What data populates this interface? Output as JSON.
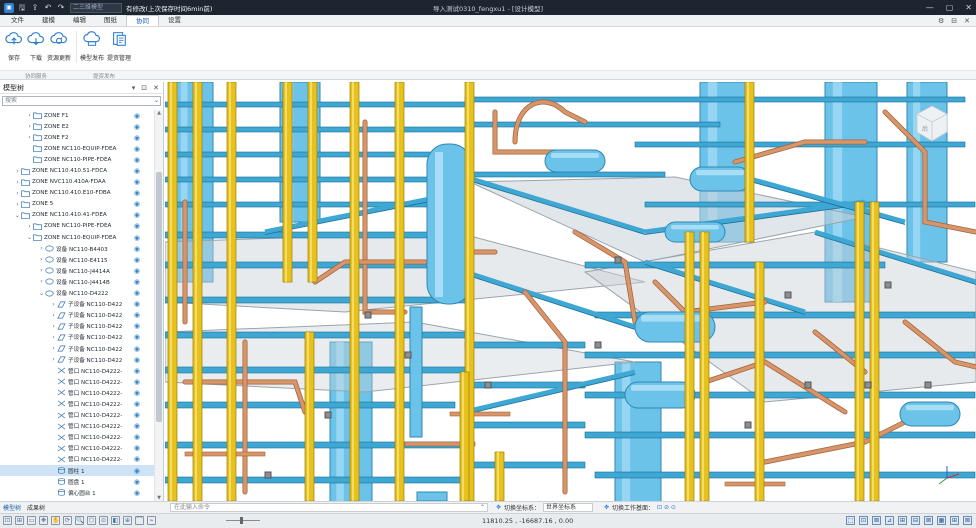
{
  "titlebar": {
    "combo_text": "二三维模型",
    "status_text": "有修改(上次保存时间6min前)",
    "window_title": "导入测试0310_fengxu1 - [设计模型]",
    "minimize": "—",
    "maximize": "▢",
    "close": "✕"
  },
  "tabs": {
    "items": [
      "文件",
      "建模",
      "编辑",
      "图纸",
      "协同",
      "设置"
    ],
    "active_index": 4,
    "right_controls": [
      "⚙",
      "⊟",
      "✕"
    ]
  },
  "ribbon": {
    "buttons": [
      {
        "label": "保存",
        "icon": "save-cloud-icon"
      },
      {
        "label": "下载",
        "icon": "download-cloud-icon"
      },
      {
        "label": "资源更新",
        "icon": "refresh-cloud-icon"
      },
      {
        "label": "模型发布",
        "icon": "publish-cloud-icon"
      },
      {
        "label": "提资管理",
        "icon": "document-manage-icon"
      }
    ],
    "groups": [
      "协同服务",
      "提资发布"
    ]
  },
  "panel": {
    "title": "模型树",
    "search_placeholder": "搜索",
    "controls": [
      "▾",
      "⊡",
      "✕"
    ]
  },
  "tree": [
    {
      "indent": 3,
      "exp": "›",
      "icon": "folder",
      "label": "ZONE F1"
    },
    {
      "indent": 3,
      "exp": "›",
      "icon": "folder",
      "label": "ZONE E2"
    },
    {
      "indent": 3,
      "exp": "›",
      "icon": "folder",
      "label": "ZONE F2"
    },
    {
      "indent": 3,
      "exp": "",
      "icon": "folder",
      "label": "ZONE NC110-EQUIP-FDEA"
    },
    {
      "indent": 3,
      "exp": "",
      "icon": "folder",
      "label": "ZONE NC110-PIPE-FDEA"
    },
    {
      "indent": 2,
      "exp": "›",
      "icon": "folder",
      "label": "ZONE NC110.410.51-FDCA"
    },
    {
      "indent": 2,
      "exp": "›",
      "icon": "folder",
      "label": "ZONE NVC110.410A-FDAA"
    },
    {
      "indent": 2,
      "exp": "›",
      "icon": "folder",
      "label": "ZONE NC110.410.E10-FDBA"
    },
    {
      "indent": 2,
      "exp": "›",
      "icon": "folder",
      "label": "ZONE 5"
    },
    {
      "indent": 2,
      "exp": "⌄",
      "icon": "folder",
      "label": "ZONE NC110.410.41-FDEA"
    },
    {
      "indent": 3,
      "exp": "›",
      "icon": "folder",
      "label": "ZONE NC110-PIPE-FDEA"
    },
    {
      "indent": 3,
      "exp": "⌄",
      "icon": "folder",
      "label": "ZONE NC110-EQUIP-FDEA"
    },
    {
      "indent": 4,
      "exp": "›",
      "icon": "equip",
      "label": "设备 NC110-B4403"
    },
    {
      "indent": 4,
      "exp": "›",
      "icon": "equip",
      "label": "设备 NC110-E4115"
    },
    {
      "indent": 4,
      "exp": "›",
      "icon": "equip",
      "label": "设备 NC110-J4414A"
    },
    {
      "indent": 4,
      "exp": "›",
      "icon": "equip",
      "label": "设备 NC110-J4414B"
    },
    {
      "indent": 4,
      "exp": "⌄",
      "icon": "equip",
      "label": "设备 NC110-D4222"
    },
    {
      "indent": 5,
      "exp": "›",
      "icon": "subequip",
      "label": "子设备 NC110-D422"
    },
    {
      "indent": 5,
      "exp": "›",
      "icon": "subequip",
      "label": "子设备 NC110-D422"
    },
    {
      "indent": 5,
      "exp": "›",
      "icon": "subequip",
      "label": "子设备 NC110-D422"
    },
    {
      "indent": 5,
      "exp": "›",
      "icon": "subequip",
      "label": "子设备 NC110-D422"
    },
    {
      "indent": 5,
      "exp": "›",
      "icon": "subequip",
      "label": "子设备 NC110-D422"
    },
    {
      "indent": 5,
      "exp": "›",
      "icon": "subequip",
      "label": "子设备 NC110-D422"
    },
    {
      "indent": 5,
      "exp": "",
      "icon": "nozzle",
      "label": "管口 NC110-D4222-"
    },
    {
      "indent": 5,
      "exp": "",
      "icon": "nozzle",
      "label": "管口 NC110-D4222-"
    },
    {
      "indent": 5,
      "exp": "",
      "icon": "nozzle",
      "label": "管口 NC110-D4222-"
    },
    {
      "indent": 5,
      "exp": "",
      "icon": "nozzle",
      "label": "管口 NC110-D4222-"
    },
    {
      "indent": 5,
      "exp": "",
      "icon": "nozzle",
      "label": "管口 NC110-D4222-"
    },
    {
      "indent": 5,
      "exp": "",
      "icon": "nozzle",
      "label": "管口 NC110-D4222-"
    },
    {
      "indent": 5,
      "exp": "",
      "icon": "nozzle",
      "label": "管口 NC110-D4222-"
    },
    {
      "indent": 5,
      "exp": "",
      "icon": "nozzle",
      "label": "管口 NC110-D4222-"
    },
    {
      "indent": 5,
      "exp": "",
      "icon": "nozzle",
      "label": "管口 NC110-D4222-"
    },
    {
      "indent": 5,
      "exp": "",
      "icon": "cylinder",
      "label": "圆柱 1",
      "selected": true
    },
    {
      "indent": 5,
      "exp": "",
      "icon": "cylinder",
      "label": "圆盘 1"
    },
    {
      "indent": 5,
      "exp": "",
      "icon": "cylinder",
      "label": "偏心圆台 1"
    }
  ],
  "bottom": {
    "tabs": [
      "模型树",
      "成果树"
    ],
    "active_index": 0,
    "command_placeholder": "在此输入命令",
    "coord_label": "切换坐标系：",
    "coord_value": "世界坐标系",
    "workplane_label": "切换工作基面：",
    "workplane_value": "⊡ ⊘ ⊙"
  },
  "status": {
    "coordinates": "11810.25 , -16687.16 , 0.00",
    "left_tools": [
      "⊡",
      "⊞",
      "▭",
      "✥",
      "✋",
      "⟳",
      "🔍",
      "⬡",
      "⊙",
      "◧",
      "⊕",
      "⌒",
      "⌁"
    ],
    "right_tools": [
      "⬚",
      "⊡",
      "⊠",
      "⊿",
      "⊞",
      "⊟",
      "⊠",
      "▦",
      "⊞",
      "⊠"
    ]
  },
  "viewcube": {
    "front_label": "后"
  }
}
